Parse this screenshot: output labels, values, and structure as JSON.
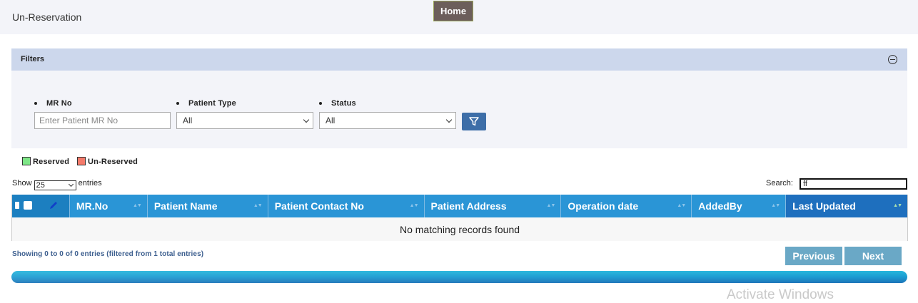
{
  "header": {
    "title": "Un-Reservation",
    "home_label": "Home"
  },
  "filters": {
    "title": "Filters",
    "mr_no": {
      "label": "MR No",
      "placeholder": "Enter Patient MR No",
      "value": ""
    },
    "patient_type": {
      "label": "Patient Type",
      "selected": "All"
    },
    "status": {
      "label": "Status",
      "selected": "All"
    }
  },
  "legend": {
    "items": [
      {
        "label": "Reserved",
        "color": "#7ee687"
      },
      {
        "label": "Un-Reserved",
        "color": "#f47a6a"
      }
    ]
  },
  "table_controls": {
    "show_label": "Show",
    "entries_label": "entries",
    "page_size": "25",
    "search_label": "Search:",
    "search_value": "ff"
  },
  "table": {
    "columns": [
      "MR.No",
      "Patient Name",
      "Patient Contact No",
      "Patient Address",
      "Operation date",
      "AddedBy",
      "Last Updated"
    ],
    "empty_message": "No matching records found"
  },
  "footer": {
    "info": "Showing 0 to 0 of 0 entries (filtered from 1 total entries)",
    "previous_label": "Previous",
    "next_label": "Next",
    "progress_fraction": 1.0
  },
  "watermark": "Activate Windows"
}
